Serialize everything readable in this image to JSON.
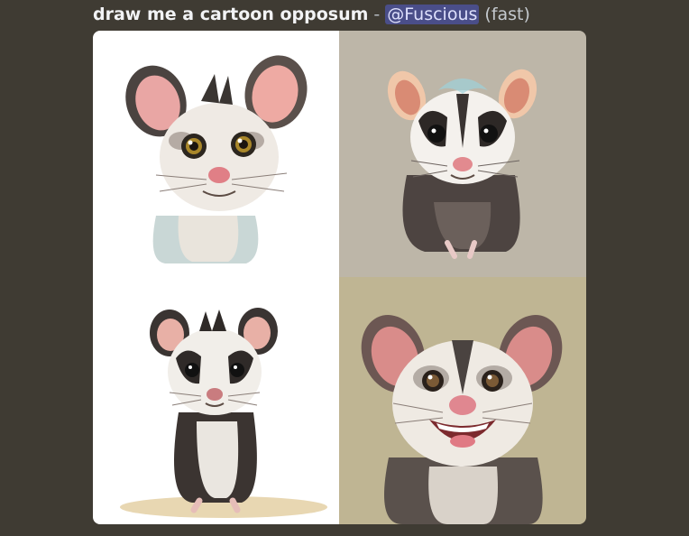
{
  "message": {
    "prompt": "draw me a cartoon opposum",
    "separator": "-",
    "mention": "@Fuscious",
    "speed": "(fast)"
  },
  "image_grid": {
    "tiles": [
      {
        "background": "#ffffff",
        "subject": "cartoon-opossum-portrait"
      },
      {
        "background": "#bdb6a8",
        "subject": "cartoon-opossum-sitting"
      },
      {
        "background": "#ffffff",
        "subject": "cartoon-opossum-standing"
      },
      {
        "background": "#bfb593",
        "subject": "cartoon-opossum-smiling"
      }
    ]
  },
  "colors": {
    "page_background": "#3f3b33",
    "mention_background": "#5865f2"
  }
}
